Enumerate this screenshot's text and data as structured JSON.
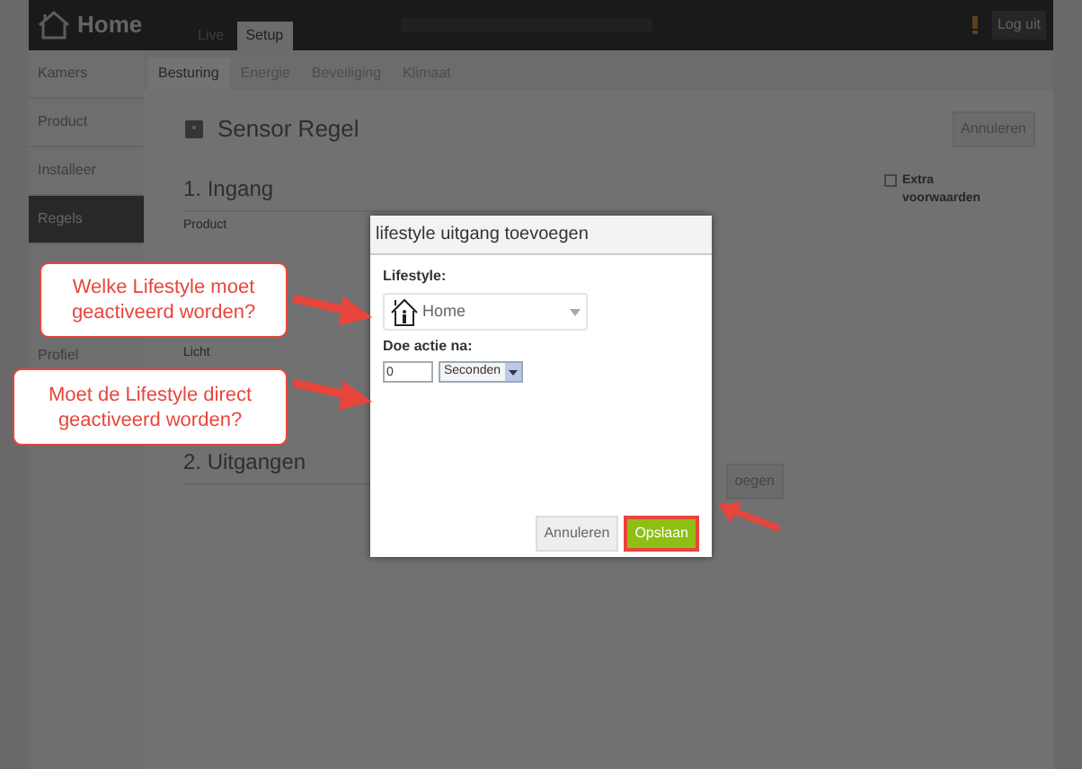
{
  "header": {
    "title": "Home",
    "logout": "Log uit"
  },
  "top_tabs": [
    {
      "label": "Live",
      "selected": false
    },
    {
      "label": "Setup",
      "selected": true
    }
  ],
  "sidebar": {
    "items": [
      {
        "label": "Kamers",
        "selected": false
      },
      {
        "label": "Product",
        "selected": false
      },
      {
        "label": "Installeer",
        "selected": false
      },
      {
        "label": "Regels",
        "selected": true
      },
      {
        "label": "Profiel",
        "selected": false
      }
    ]
  },
  "sub_tabs": [
    {
      "label": "Besturing",
      "selected": true
    },
    {
      "label": "Energie",
      "selected": false
    },
    {
      "label": "Beveiliging",
      "selected": false
    },
    {
      "label": "Klimaat",
      "selected": false
    }
  ],
  "page": {
    "title": "Sensor Regel",
    "cancel": "Annuleren",
    "extra": {
      "label": "Extra voorwaarden",
      "checked": false
    },
    "section_1": "1. Ingang",
    "fields": [
      "Product",
      "Licht"
    ],
    "section_2": "2. Uitgangen",
    "add_button": "oegen"
  },
  "dialog": {
    "title": "lifestyle uitgang toevoegen",
    "lifestyle_label": "Lifestyle:",
    "lifestyle_value": "Home",
    "delay_label": "Doe actie na:",
    "delay_value": "0",
    "unit": "Seconden",
    "cancel": "Annuleren",
    "save": "Opslaan"
  },
  "callouts": [
    "Welke Lifestyle moet geactiveerd worden?",
    "Moet de Lifestyle direct geactiveerd worden?"
  ]
}
